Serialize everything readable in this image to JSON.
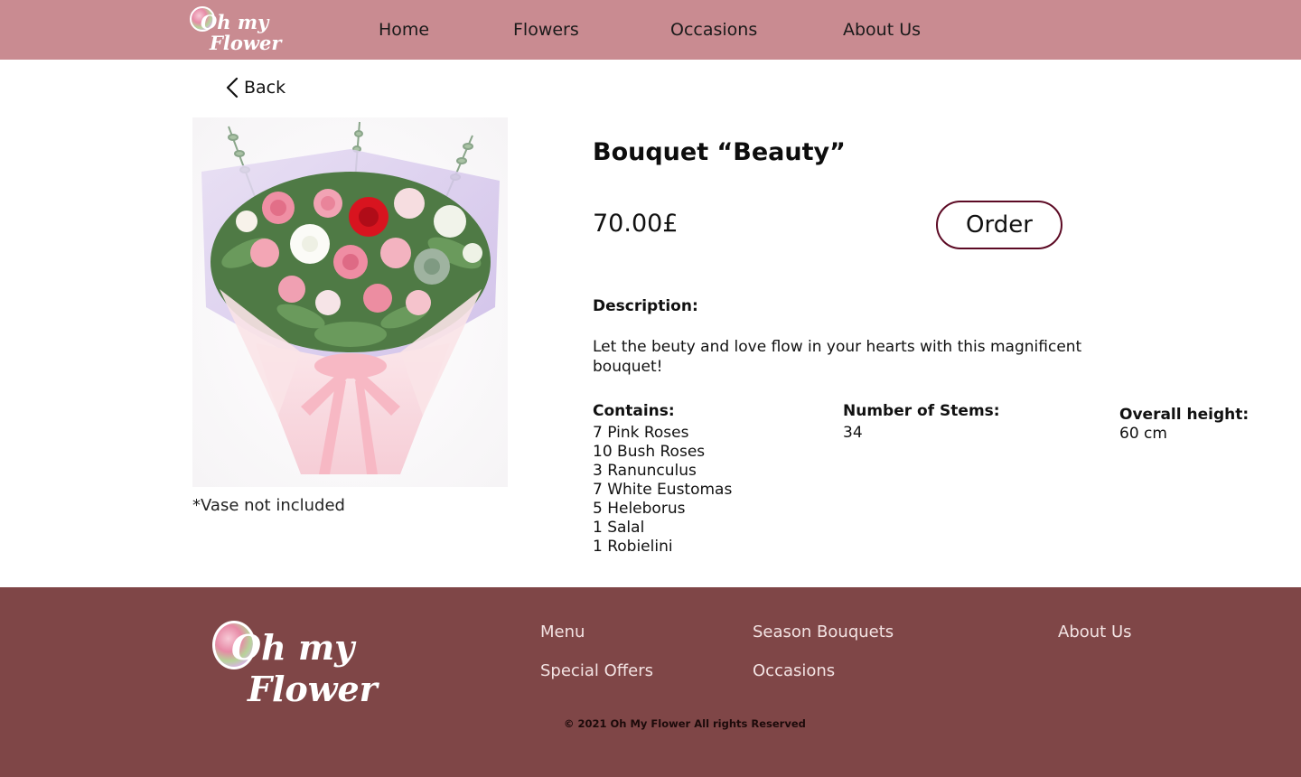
{
  "header": {
    "logo_line1": "Oh my",
    "logo_line2": "Flower",
    "nav": [
      "Home",
      "Flowers",
      "Occasions",
      "About Us"
    ]
  },
  "back_label": "Back",
  "product": {
    "title": "Bouquet “Beauty”",
    "price": "70.00£",
    "order_label": "Order",
    "vase_note": "*Vase not included",
    "description_label": "Description:",
    "description": "Let the beuty and love flow in your hearts with this magnificent bouquet!",
    "contains_label": "Contains:",
    "contains": [
      "7 Pink Roses",
      "10 Bush Roses",
      "3 Ranunculus",
      "7 White Eustomas",
      "5 Heleborus",
      "1 Salal",
      "1 Robielini"
    ],
    "stems_label": "Number of Stems:",
    "stems": "34",
    "height_label": "Overall height:",
    "height": "60 cm"
  },
  "footer": {
    "logo_line1": "Oh my",
    "logo_line2": "Flower",
    "links": [
      "Menu",
      "Season Bouquets",
      "About Us",
      "Special Offers",
      "Occasions"
    ],
    "copyright": "© 2021  Oh My Flower All rights Reserved"
  },
  "colors": {
    "header_bg": "#c98b91",
    "footer_bg": "#7f4647",
    "order_border": "#5c0a24"
  }
}
